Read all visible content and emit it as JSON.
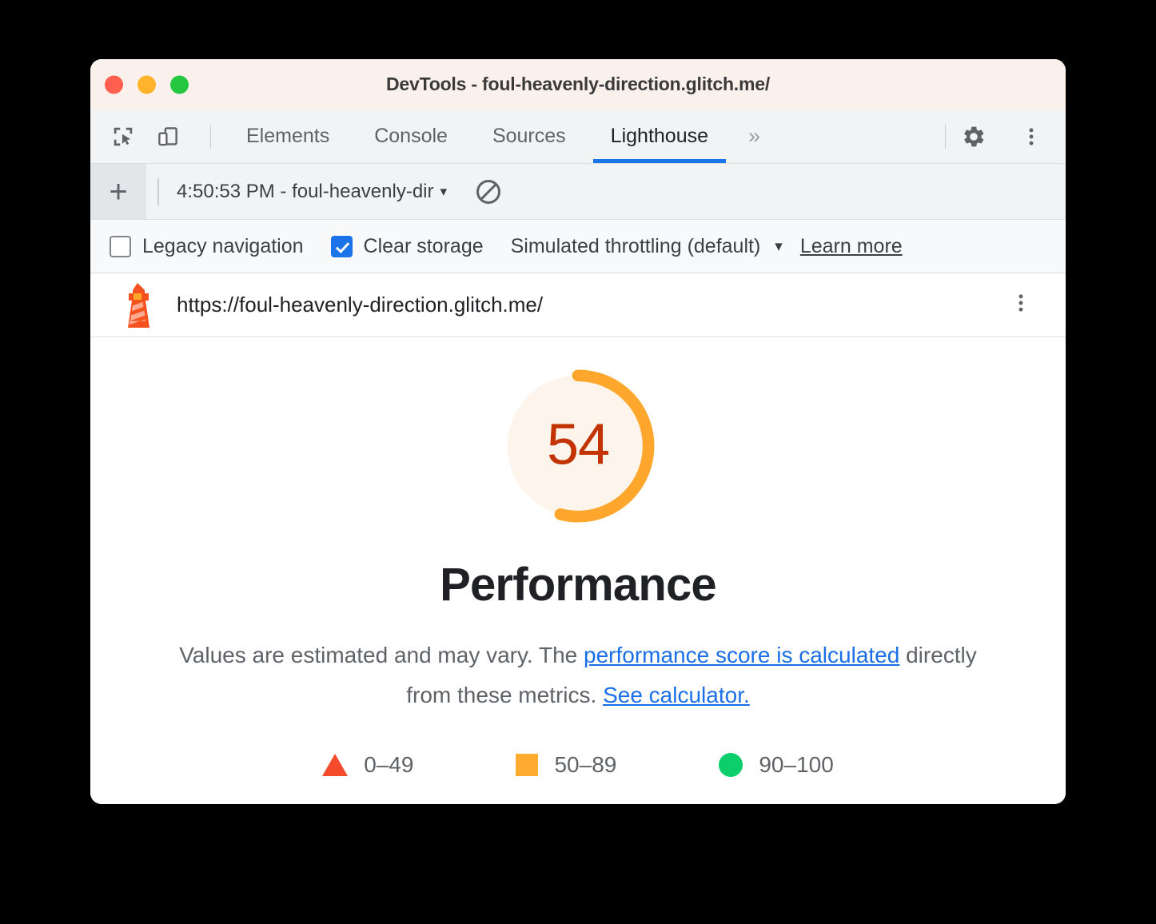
{
  "window": {
    "title": "DevTools - foul-heavenly-direction.glitch.me/",
    "traffic_lights": [
      "close",
      "minimize",
      "zoom"
    ]
  },
  "devtools": {
    "left_icons": [
      {
        "name": "inspect-element-icon",
        "label": "Inspect element"
      },
      {
        "name": "device-toolbar-icon",
        "label": "Toggle device toolbar"
      }
    ],
    "tabs": [
      {
        "label": "Elements",
        "active": false
      },
      {
        "label": "Console",
        "active": false
      },
      {
        "label": "Sources",
        "active": false
      },
      {
        "label": "Lighthouse",
        "active": true
      }
    ],
    "more_tabs_glyph": "»",
    "right_icons": [
      {
        "name": "settings-gear-icon",
        "label": "Settings"
      },
      {
        "name": "more-options-kebab-icon",
        "label": "Customize and control DevTools"
      }
    ],
    "active_tab_underline_color": "#1a73e8"
  },
  "runbar": {
    "add_button_label": "+",
    "run_selector_value": "4:50:53 PM - foul-heavenly-dir",
    "run_selector_caret": "▾",
    "clear_icon_name": "clear-all-icon"
  },
  "options": {
    "legacy_navigation": {
      "label": "Legacy navigation",
      "checked": false
    },
    "clear_storage": {
      "label": "Clear storage",
      "checked": true
    },
    "throttling": {
      "label": "Simulated throttling (default)",
      "caret": "▾"
    },
    "learn_more": "Learn more",
    "checkbox_accent": "#1a73e8"
  },
  "report_header": {
    "icon_name": "lighthouse-icon",
    "url": "https://foul-heavenly-direction.glitch.me/",
    "kebab_label": "Report options"
  },
  "report": {
    "category": "Performance",
    "score": "54",
    "description_part1": "Values are estimated and may vary. The ",
    "link1": "performance score is calculated",
    "description_part2": " directly from these metrics. ",
    "link2": "See calculator.",
    "legend": [
      {
        "shape": "triangle",
        "label": "0–49",
        "color": "#f44b2a"
      },
      {
        "shape": "square",
        "label": "50–89",
        "color": "#ffab30"
      },
      {
        "shape": "circle",
        "label": "90–100",
        "color": "#0cce6b"
      }
    ]
  },
  "chart_data": {
    "type": "pie",
    "title": "Performance",
    "categories": [
      "score",
      "remaining"
    ],
    "values": [
      54,
      46
    ],
    "value_label": "54",
    "score_range": [
      0,
      100
    ],
    "gauge_arc_color": "#ffa62c",
    "gauge_track_color": "#fdf4ec",
    "gauge_text_color": "#c33300",
    "thresholds": [
      {
        "range": "0–49",
        "color": "#f44b2a"
      },
      {
        "range": "50–89",
        "color": "#ffab30"
      },
      {
        "range": "90–100",
        "color": "#0cce6b"
      }
    ]
  }
}
